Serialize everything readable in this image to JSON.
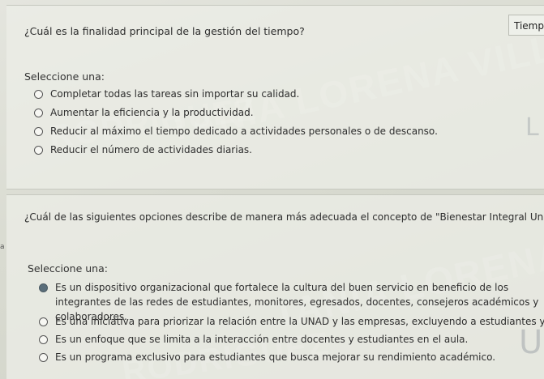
{
  "question1": {
    "text": "¿Cuál es la finalidad principal de la gestión del tiempo?",
    "prompt": "Seleccione una:",
    "flag_label": "Tiempo",
    "options": [
      {
        "label": "Completar todas las tareas sin importar su calidad.",
        "selected": false
      },
      {
        "label": "Aumentar la eficiencia y la productividad.",
        "selected": false
      },
      {
        "label": "Reducir al máximo el tiempo dedicado a actividades personales o de descanso.",
        "selected": false
      },
      {
        "label": "Reducir el número de actividades diarias.",
        "selected": false
      }
    ]
  },
  "question2": {
    "text": "¿Cuál de las siguientes opciones describe de manera más adecuada el concepto de \"Bienestar Integral Unadista\"?",
    "prompt": "Seleccione una:",
    "side_mark": "a",
    "options": [
      {
        "label": "Es un dispositivo organizacional que fortalece la cultura del buen servicio en beneficio de los integrantes de las redes de estudiantes, monitores, egresados, docentes, consejeros académicos y colaboradores.",
        "selected": true
      },
      {
        "label": "Es una iniciativa para priorizar la relación entre la UNAD y las empresas, excluyendo a estudiantes y egresados.",
        "selected": false
      },
      {
        "label": "Es un enfoque que se limita a la interacción entre docentes y estudiantes en el aula.",
        "selected": false
      },
      {
        "label": "Es un programa exclusivo para estudiantes que busca mejorar su rendimiento académico.",
        "selected": false
      }
    ]
  },
  "watermark": {
    "line1": "TANIA LORENA VILLALOBOS",
    "line2": "RODRIGUEZ"
  }
}
